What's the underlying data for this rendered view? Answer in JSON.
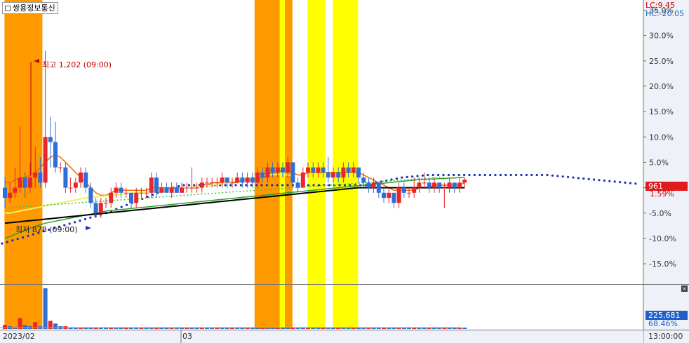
{
  "header": {
    "title": "쌍용정보통신",
    "lc_label": "LC:9.45",
    "hc_label": "HC:-20.05",
    "price_badge": "961",
    "price_change": "1.59%",
    "volume_badge": "225,681",
    "volume_pct": "68.46%",
    "close_icon": "close-icon"
  },
  "annotations": {
    "high_label": "최고 1,202 (09:00)",
    "low_label": "최저 878 (09:00)"
  },
  "x_axis": {
    "labels": [
      "2023/02",
      "03"
    ],
    "right_label": "13:00:00"
  },
  "colors": {
    "orange_band": "#ff9900",
    "yellow_band": "#ffff00",
    "up_candle": "#e8262b",
    "down_candle": "#2f6ed8",
    "ma_orange": "#f06a00",
    "ma_yellow": "#f0f060",
    "ma_green": "#2ca02c",
    "ma_black": "#000000",
    "psar": "#1a2fb5"
  },
  "chart_data": {
    "type": "line",
    "title": "쌍용정보통신",
    "ylabel": "",
    "xlabel": "",
    "y_unit": "%",
    "y_ticks": [
      35,
      30,
      25,
      20,
      15,
      10,
      5,
      0,
      -5,
      -10,
      -15
    ],
    "ylim": [
      -19,
      37
    ],
    "x_labels": [
      "2023/02",
      "03"
    ],
    "highlight_bands": [
      {
        "start": 0,
        "end": 7.5,
        "color": "orange"
      },
      {
        "start": 49.5,
        "end": 54.5,
        "color": "orange"
      },
      {
        "start": 54.5,
        "end": 55.5,
        "color": "yellow"
      },
      {
        "start": 55.5,
        "end": 57,
        "color": "orange"
      },
      {
        "start": 60,
        "end": 63.5,
        "color": "yellow"
      },
      {
        "start": 65,
        "end": 70,
        "color": "yellow"
      }
    ],
    "candles": [
      {
        "o": 0,
        "c": -2,
        "h": 2,
        "l": -4
      },
      {
        "o": -2,
        "c": -1,
        "h": 1,
        "l": -3
      },
      {
        "o": -1,
        "c": 0,
        "h": 4,
        "l": -2
      },
      {
        "o": 0,
        "c": 2,
        "h": 12,
        "l": -1
      },
      {
        "o": 2,
        "c": 0,
        "h": 3,
        "l": -2
      },
      {
        "o": 0,
        "c": 2,
        "h": 5,
        "l": -1
      },
      {
        "o": 2,
        "c": 3,
        "h": 8,
        "l": 0
      },
      {
        "o": 3,
        "c": 1,
        "h": 6,
        "l": 0
      },
      {
        "o": 1,
        "c": 10,
        "h": 27,
        "l": 0
      },
      {
        "o": 10,
        "c": 9,
        "h": 14,
        "l": 4
      },
      {
        "o": 9,
        "c": 4,
        "h": 13,
        "l": 3
      },
      {
        "o": 4,
        "c": 4,
        "h": 5,
        "l": 3
      },
      {
        "o": 4,
        "c": 0,
        "h": 5,
        "l": -1
      },
      {
        "o": 0,
        "c": 0,
        "h": 2,
        "l": -1
      },
      {
        "o": 0,
        "c": 1,
        "h": 2,
        "l": -1
      },
      {
        "o": 1,
        "c": 3,
        "h": 4,
        "l": 0
      },
      {
        "o": 3,
        "c": 0,
        "h": 4,
        "l": -1
      },
      {
        "o": 0,
        "c": -3,
        "h": 1,
        "l": -4
      },
      {
        "o": -3,
        "c": -5,
        "h": -2,
        "l": -6
      },
      {
        "o": -5,
        "c": -3,
        "h": -2,
        "l": -6
      },
      {
        "o": -3,
        "c": -3,
        "h": -2,
        "l": -4
      },
      {
        "o": -3,
        "c": -1,
        "h": 0,
        "l": -4
      },
      {
        "o": -1,
        "c": 0,
        "h": 1,
        "l": -2
      },
      {
        "o": 0,
        "c": -1,
        "h": 1,
        "l": -2
      },
      {
        "o": -1,
        "c": -1,
        "h": 0,
        "l": -2
      },
      {
        "o": -1,
        "c": -3,
        "h": -1,
        "l": -4
      },
      {
        "o": -3,
        "c": -1,
        "h": 0,
        "l": -4
      },
      {
        "o": -1,
        "c": -1,
        "h": 0,
        "l": -2
      },
      {
        "o": -1,
        "c": -1,
        "h": 0,
        "l": -2
      },
      {
        "o": -1,
        "c": 2,
        "h": 3,
        "l": -2
      },
      {
        "o": 2,
        "c": -1,
        "h": 3,
        "l": -2
      },
      {
        "o": -1,
        "c": 0,
        "h": 1,
        "l": -1
      },
      {
        "o": 0,
        "c": -1,
        "h": 1,
        "l": -1
      },
      {
        "o": -1,
        "c": 0,
        "h": 1,
        "l": -2
      },
      {
        "o": 0,
        "c": -1,
        "h": 1,
        "l": -1
      },
      {
        "o": -1,
        "c": 0,
        "h": 1,
        "l": -1
      },
      {
        "o": 0,
        "c": 0,
        "h": 1,
        "l": -1
      },
      {
        "o": 0,
        "c": 0,
        "h": 4,
        "l": -1
      },
      {
        "o": 0,
        "c": 0,
        "h": 1,
        "l": -1
      },
      {
        "o": 0,
        "c": 1,
        "h": 2,
        "l": -1
      },
      {
        "o": 1,
        "c": 1,
        "h": 2,
        "l": 0
      },
      {
        "o": 1,
        "c": 1,
        "h": 2,
        "l": 0
      },
      {
        "o": 1,
        "c": 1,
        "h": 2,
        "l": 0
      },
      {
        "o": 1,
        "c": 2,
        "h": 3,
        "l": 0
      },
      {
        "o": 2,
        "c": 1,
        "h": 2,
        "l": 0
      },
      {
        "o": 1,
        "c": 1,
        "h": 2,
        "l": 0
      },
      {
        "o": 1,
        "c": 2,
        "h": 3,
        "l": 1
      },
      {
        "o": 2,
        "c": 1,
        "h": 3,
        "l": 0
      },
      {
        "o": 1,
        "c": 2,
        "h": 3,
        "l": 0
      },
      {
        "o": 2,
        "c": 1,
        "h": 3,
        "l": 0
      },
      {
        "o": 1,
        "c": 3,
        "h": 4,
        "l": 0
      },
      {
        "o": 3,
        "c": 2,
        "h": 4,
        "l": 1
      },
      {
        "o": 2,
        "c": 4,
        "h": 5,
        "l": 1
      },
      {
        "o": 4,
        "c": 3,
        "h": 5,
        "l": 2
      },
      {
        "o": 3,
        "c": 4,
        "h": 5,
        "l": 2
      },
      {
        "o": 4,
        "c": 3,
        "h": 5,
        "l": 2
      },
      {
        "o": 3,
        "c": 5,
        "h": 6,
        "l": 2
      },
      {
        "o": 5,
        "c": 1,
        "h": 5,
        "l": 0
      },
      {
        "o": 1,
        "c": 0,
        "h": 2,
        "l": -1
      },
      {
        "o": 0,
        "c": 3,
        "h": 4,
        "l": 0
      },
      {
        "o": 3,
        "c": 4,
        "h": 5,
        "l": 2
      },
      {
        "o": 4,
        "c": 3,
        "h": 5,
        "l": 2
      },
      {
        "o": 3,
        "c": 4,
        "h": 5,
        "l": 2
      },
      {
        "o": 4,
        "c": 3,
        "h": 5,
        "l": 2
      },
      {
        "o": 3,
        "c": 2,
        "h": 6,
        "l": 1
      },
      {
        "o": 2,
        "c": 3,
        "h": 4,
        "l": 1
      },
      {
        "o": 3,
        "c": 2,
        "h": 4,
        "l": 1
      },
      {
        "o": 2,
        "c": 4,
        "h": 5,
        "l": 1
      },
      {
        "o": 4,
        "c": 3,
        "h": 5,
        "l": 2
      },
      {
        "o": 3,
        "c": 4,
        "h": 5,
        "l": 2
      },
      {
        "o": 4,
        "c": 2,
        "h": 4,
        "l": 1
      },
      {
        "o": 2,
        "c": 1,
        "h": 3,
        "l": 0
      },
      {
        "o": 1,
        "c": 0,
        "h": 2,
        "l": -1
      },
      {
        "o": 0,
        "c": 1,
        "h": 2,
        "l": -1
      },
      {
        "o": 1,
        "c": -1,
        "h": 1,
        "l": -2
      },
      {
        "o": -1,
        "c": -2,
        "h": 0,
        "l": -3
      },
      {
        "o": -2,
        "c": -1,
        "h": 0,
        "l": -3
      },
      {
        "o": -1,
        "c": -3,
        "h": -1,
        "l": -4
      },
      {
        "o": -3,
        "c": 0,
        "h": 1,
        "l": -4
      },
      {
        "o": 0,
        "c": -1,
        "h": 1,
        "l": -2
      },
      {
        "o": -1,
        "c": -1,
        "h": 0,
        "l": -2
      },
      {
        "o": -1,
        "c": 0,
        "h": 2,
        "l": -2
      },
      {
        "o": 0,
        "c": 1,
        "h": 2,
        "l": -1
      },
      {
        "o": 1,
        "c": 1,
        "h": 3,
        "l": 0
      },
      {
        "o": 1,
        "c": 0,
        "h": 2,
        "l": -1
      },
      {
        "o": 0,
        "c": 1,
        "h": 2,
        "l": -1
      },
      {
        "o": 1,
        "c": 0,
        "h": 1,
        "l": -1
      },
      {
        "o": 0,
        "c": 0,
        "h": 1,
        "l": -4
      },
      {
        "o": 0,
        "c": 1,
        "h": 2,
        "l": -1
      },
      {
        "o": 1,
        "c": 0,
        "h": 1,
        "l": -1
      },
      {
        "o": 0,
        "c": 1,
        "h": 2,
        "l": -1
      },
      {
        "o": 1,
        "c": 1.59,
        "h": 2,
        "l": 0
      }
    ],
    "series": [
      {
        "values": [
          1,
          1,
          1.5,
          2,
          2,
          2.5,
          3,
          4,
          5,
          6,
          6.5,
          6,
          5,
          4,
          3,
          2,
          1,
          0,
          -1,
          -1.5,
          -1.5,
          -1,
          -0.5,
          -0.5,
          -0.5,
          -0.5,
          -0.5,
          -0.5,
          -0.5,
          0,
          0,
          0,
          0,
          0,
          0,
          0,
          0,
          0,
          0,
          0.5,
          0.5,
          1,
          1,
          1,
          1,
          1,
          1,
          1.5,
          1.5,
          1.5,
          2,
          2,
          2.5,
          3,
          3,
          3.5,
          3.5,
          3,
          2.5,
          2.5,
          3,
          3,
          3,
          3,
          3,
          3,
          3,
          3,
          3,
          3,
          3,
          2.5,
          2,
          1.5,
          1,
          0.5,
          0,
          -0.5,
          -0.5,
          -0.5,
          -0.5,
          -0.5,
          0,
          0,
          0,
          0.5,
          0.5,
          0.5,
          0.5,
          0.5,
          0.5,
          1
        ]
      },
      {
        "values": [
          -5,
          -5,
          -4.8,
          -4.6,
          -4.4,
          -4.2,
          -4,
          -3.8,
          -3.6,
          -3.4,
          -3.2,
          -3,
          -2.8,
          -2.6,
          -2.4,
          -2.2,
          -2,
          -1.9,
          -1.8,
          -1.7,
          -1.6,
          -1.5,
          -1.4,
          -1.3,
          -1.2,
          -1.1,
          -1,
          -0.9,
          -0.8,
          -0.7,
          -0.6,
          -0.5,
          -0.4,
          -0.3,
          -0.2,
          -0.1,
          0,
          0.1,
          0.2,
          0.3,
          0.4,
          0.5,
          0.6,
          0.8,
          1,
          1.2,
          1.4,
          1.6,
          1.8,
          2,
          2.2,
          2.4,
          2.5,
          2.6,
          2.6,
          2.6,
          2.5,
          2.4
        ]
      },
      {
        "values": [
          -10,
          -9.6,
          -9.2,
          -8.8,
          -8.4,
          -8,
          -7.6,
          -7.3,
          -7,
          -6.8,
          -6.6,
          -6.4,
          -6.2,
          -6,
          -5.8,
          -5.6,
          -5.4,
          -5.2,
          -5,
          -4.8,
          -4.6,
          -4.5,
          -4.4,
          -4.3,
          -4.2,
          -4.1,
          -4,
          -3.9,
          -3.8,
          -3.7,
          -3.6,
          -3.5,
          -3.4,
          -3.3,
          -3.2,
          -3.1,
          -3,
          -2.9,
          -2.8,
          -2.7,
          -2.6,
          -2.5,
          -2.4,
          -2.3,
          -2.2,
          -2.1,
          -2,
          -1.9,
          -1.8,
          -1.7,
          -1.6,
          -1.5,
          -1.4,
          -1.3,
          -1.2,
          -1.1,
          -1,
          -0.9,
          -0.8,
          -0.7,
          -0.6,
          -0.5,
          -0.4,
          -0.3,
          -0.2,
          -0.1,
          0,
          0.1,
          0.2,
          0.3,
          0.4,
          0.5,
          0.6,
          0.7,
          0.8,
          0.9,
          1,
          1.1,
          1.2,
          1.3,
          1.4,
          1.5,
          1.6,
          1.6,
          1.7,
          1.7,
          1.8,
          1.8,
          1.9,
          1.9,
          2,
          2
        ]
      },
      {
        "values": [
          -7,
          -6.9,
          -6.8,
          -6.7,
          -6.6,
          -6.5,
          -6.4,
          -6.3,
          -6.2,
          -6.1,
          -6,
          -5.9,
          -5.8,
          -5.7,
          -5.6,
          -5.5,
          -5.4,
          -5.3,
          -5.2,
          -5.1,
          -5,
          -4.9,
          -4.8,
          -4.7,
          -4.6,
          -4.5,
          -4.4,
          -4.3,
          -4.2,
          -4.1,
          -4,
          -3.9,
          -3.8,
          -3.7,
          -3.6,
          -3.5,
          -3.4,
          -3.3,
          -3.2,
          -3.1,
          -3,
          -2.9,
          -2.8,
          -2.7,
          -2.6,
          -2.5,
          -2.4,
          -2.3,
          -2.2,
          -2.1,
          -2,
          -1.9,
          -1.8,
          -1.7,
          -1.6,
          -1.5,
          -1.4,
          -1.3,
          -1.2,
          -1.1,
          -1,
          -0.9,
          -0.8,
          -0.7,
          -0.6,
          -0.5,
          -0.4,
          -0.3,
          -0.2,
          -0.1,
          0,
          0,
          0,
          0,
          0,
          0,
          0,
          0,
          0,
          0,
          0,
          0,
          0,
          0,
          0,
          0,
          0,
          0,
          0,
          0,
          0,
          0
        ]
      }
    ],
    "psar": [
      -11,
      -10.7,
      -10.4,
      -10.1,
      -9.8,
      -9.5,
      -9.2,
      -8.9,
      -8.6,
      -8.3,
      -8,
      -7.7,
      -7.4,
      -7.1,
      -6.8,
      -6.5,
      -6.2,
      -5.9,
      -5.6,
      -5.3,
      -5,
      -4.6,
      -4.2,
      -3.8,
      -3.4,
      -3,
      -2.6,
      -2.2,
      -1.8,
      -1.4,
      -1,
      -0.6,
      -0.3,
      0,
      0.3,
      0.5,
      0.5,
      0.5,
      0.5,
      0.5,
      0.5,
      0.5,
      0.5,
      0.5,
      0.5,
      0.5,
      0.5,
      0.5,
      0.5,
      0.5,
      0.5,
      0.5,
      0.5,
      0.5,
      0.5,
      0.5,
      0.5,
      0.5,
      0.5,
      0.5,
      0.5,
      0.5,
      0.5,
      0.5,
      0.5,
      0.5,
      0.5,
      0.5,
      0.5,
      0.5,
      0.5,
      0.5,
      1,
      1.2,
      1.4,
      1.6,
      1.8,
      2,
      2.1,
      2.2,
      2.3,
      2.4,
      2.5,
      2.5,
      2.5,
      2.5,
      2.5,
      2.5,
      2.5,
      2.5,
      2.5,
      2.5,
      2.5,
      2.5,
      2.5,
      2.5,
      2.5,
      2.5,
      2.5,
      2.5,
      2.5,
      2.5,
      2.5,
      2.5,
      2.5,
      2.5,
      2.4,
      2.3,
      2.2,
      2.1,
      2,
      1.9,
      1.8,
      1.7,
      1.6,
      1.5,
      1.4,
      1.3,
      1.2,
      1.1,
      1,
      0.9,
      0.8
    ],
    "volume": [
      3,
      2,
      1,
      8,
      3,
      2,
      5,
      2,
      30,
      6,
      4,
      2,
      2,
      1,
      1,
      1,
      1,
      1,
      1,
      1,
      1,
      1,
      1,
      1,
      1,
      1,
      1,
      1,
      1,
      1,
      1,
      1,
      1,
      1,
      1,
      1,
      1,
      1,
      1,
      1,
      1,
      1,
      1,
      1,
      1,
      1,
      1,
      1,
      1,
      1,
      1,
      1,
      1,
      1,
      1,
      1,
      1,
      1,
      1,
      1,
      1,
      1,
      1,
      1,
      1,
      1,
      1,
      1,
      1,
      1,
      1,
      1,
      1,
      1,
      1,
      1,
      1,
      1,
      1,
      1,
      1,
      1,
      1,
      1,
      1,
      1,
      1,
      1,
      1,
      1,
      1,
      1
    ]
  }
}
